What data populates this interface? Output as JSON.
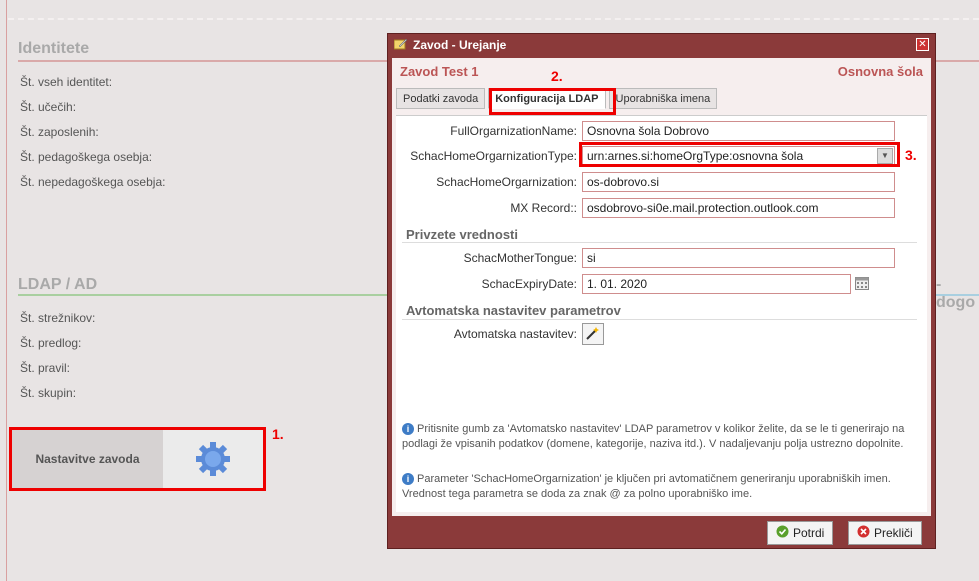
{
  "background": {
    "sections": [
      {
        "title": "Identitete",
        "rows": [
          "Št. vseh identitet:",
          "Št. učečih:",
          "Št. zaposlenih:",
          "Št. pedagoškega osebja:",
          "Št. nepedagoškega osebja:"
        ]
      },
      {
        "title": "LDAP / AD",
        "rows": [
          "Št. strežnikov:",
          "Št. predlog:",
          "Št. pravil:",
          "Št. skupin:"
        ]
      }
    ],
    "right_fragment": "- dogo",
    "settings_button_label": "Nastavitve zavoda",
    "markers": {
      "one": "1.",
      "two": "2.",
      "three": "3."
    }
  },
  "dialog": {
    "title": "Zavod - Urejanje",
    "institution_name": "Zavod Test 1",
    "institution_type": "Osnovna šola",
    "tabs": [
      {
        "label": "Podatki zavoda",
        "active": false
      },
      {
        "label": "Konfiguracija LDAP",
        "active": true
      },
      {
        "label": "Uporabniška imena",
        "active": false
      }
    ],
    "fields": [
      {
        "label": "FullOrgarnizationName:",
        "value": "Osnovna šola Dobrovo"
      },
      {
        "label": "SchacHomeOrgarnizationType:",
        "value": "urn:arnes.si:homeOrgType:osnovna šola"
      },
      {
        "label": "SchacHomeOrgarnization:",
        "value": "os-dobrovo.si"
      },
      {
        "label": "MX Record::",
        "value": "osdobrovo-si0e.mail.protection.outlook.com"
      }
    ],
    "section_defaults": "Privzete vrednosti",
    "default_fields": [
      {
        "label": "SchacMotherTongue:",
        "value": "si"
      },
      {
        "label": "SchacExpiryDate:",
        "value": "1. 01. 2020"
      }
    ],
    "section_auto": "Avtomatska nastavitev parametrov",
    "auto_label": "Avtomatska nastavitev:",
    "info_1": "Pritisnite gumb za 'Avtomatsko nastavitev' LDAP parametrov v kolikor želite, da se le ti generirajo na podlagi že vpisanih podatkov (domene, kategorije, naziva itd.). V nadaljevanju polja ustrezno dopolnite.",
    "info_2": "Parameter 'SchacHomeOrgarnization' je ključen pri avtomatičnem generiranju uporabniških imen. Vrednost tega parametra se doda za znak @ za polno uporabniško ime.",
    "confirm_label": "Potrdi",
    "cancel_label": "Prekliči"
  }
}
